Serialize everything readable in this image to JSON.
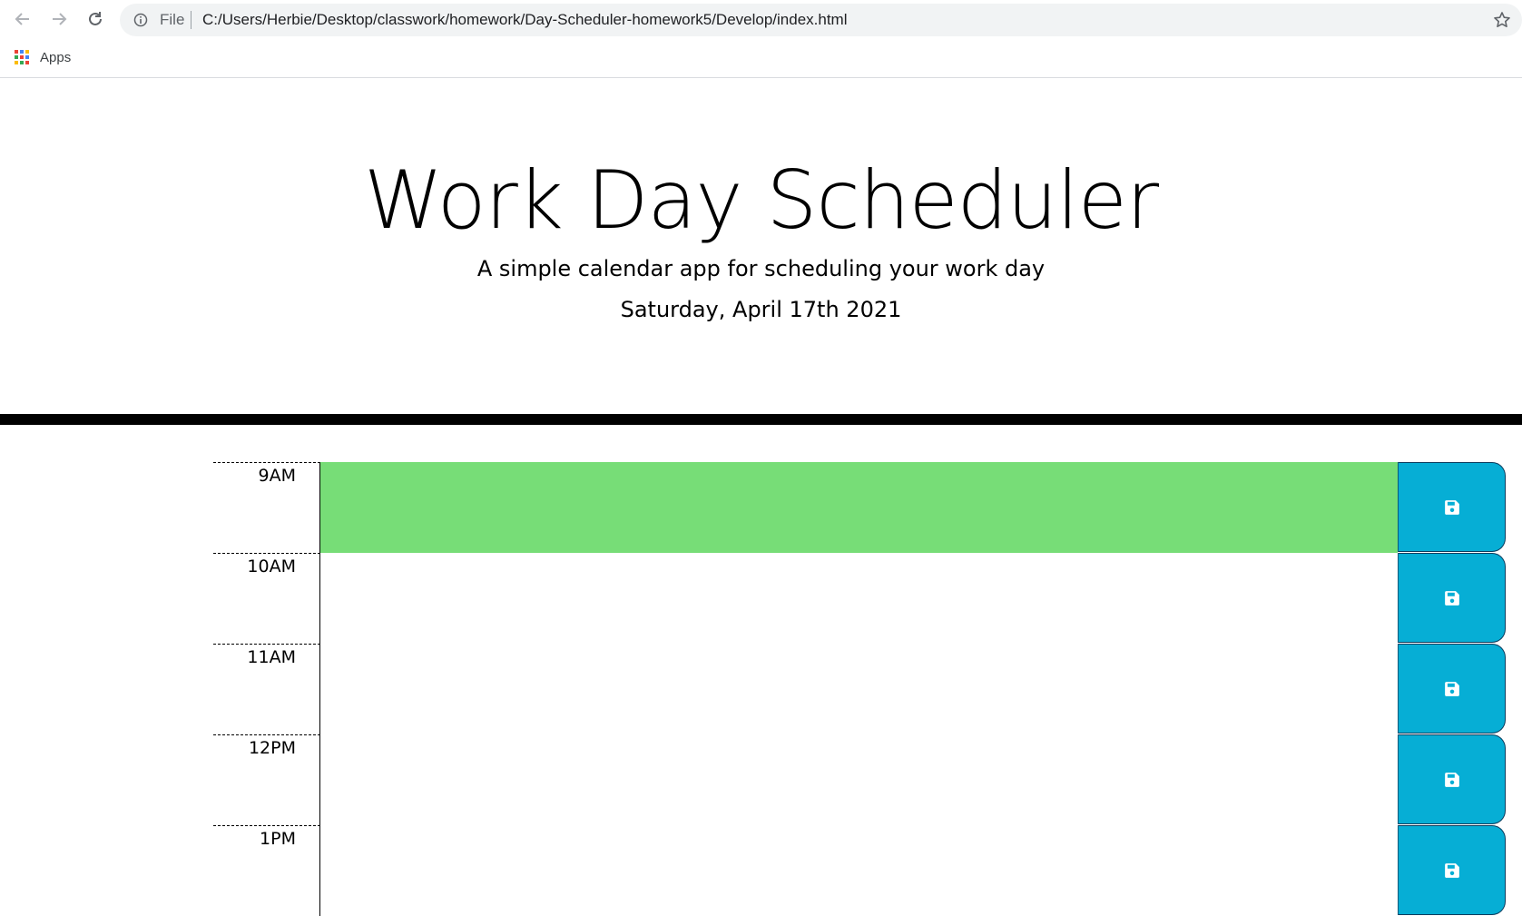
{
  "browser": {
    "file_label": "File",
    "url": "C:/Users/Herbie/Desktop/classwork/homework/Day-Scheduler-homework5/Develop/index.html",
    "bookmarks": [
      {
        "label": "Apps",
        "icon": "apps-grid-icon"
      }
    ]
  },
  "header": {
    "title": "Work Day Scheduler",
    "lead": "A simple calendar app for scheduling your work day",
    "current_day": "Saturday, April 17th 2021"
  },
  "time_blocks": [
    {
      "hour": "9AM",
      "status": "present",
      "text": "",
      "save_icon": "floppy-disk-icon"
    },
    {
      "hour": "10AM",
      "status": "future",
      "text": "",
      "save_icon": "floppy-disk-icon"
    },
    {
      "hour": "11AM",
      "status": "future",
      "text": "",
      "save_icon": "floppy-disk-icon"
    },
    {
      "hour": "12PM",
      "status": "future",
      "text": "",
      "save_icon": "floppy-disk-icon"
    },
    {
      "hour": "1PM",
      "status": "future",
      "text": "",
      "save_icon": "floppy-disk-icon"
    }
  ],
  "colors": {
    "present": "#77dd77",
    "save_button": "#06aed5",
    "rule": "#000000"
  }
}
